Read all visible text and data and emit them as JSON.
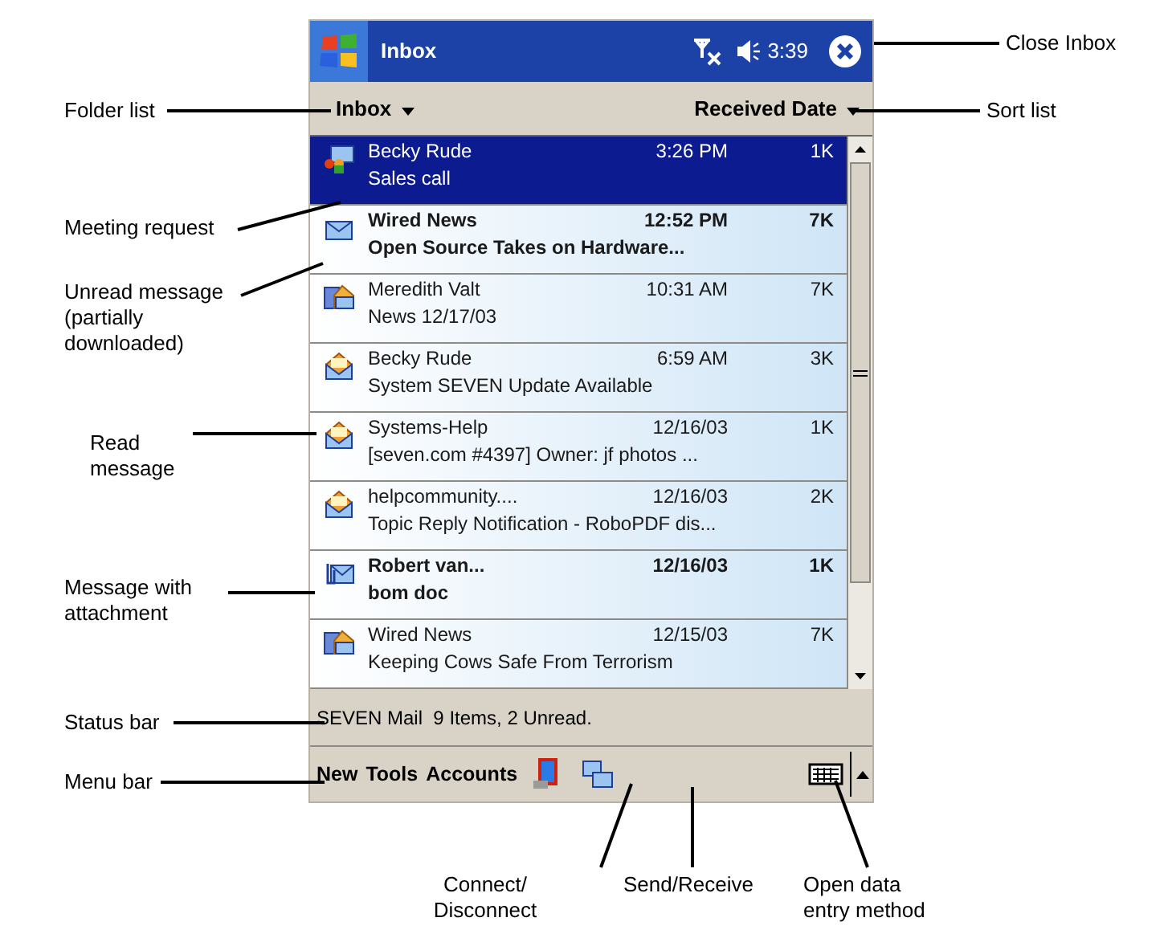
{
  "title_bar": {
    "title": "Inbox",
    "time": "3:39"
  },
  "folder_list": {
    "label": "Inbox"
  },
  "sort_list": {
    "label": "Received Date"
  },
  "messages": [
    {
      "sender": "Becky Rude",
      "time": "3:26 PM",
      "size": "1K",
      "subject": "Sales call",
      "kind": "meeting",
      "unread": false,
      "selected": true
    },
    {
      "sender": "Wired News",
      "time": "12:52 PM",
      "size": "7K",
      "subject": "Open Source Takes on Hardware...",
      "kind": "unread",
      "unread": true,
      "selected": false
    },
    {
      "sender": "Meredith Valt",
      "time": "10:31 AM",
      "size": "7K",
      "subject": "News 12/17/03",
      "kind": "partial",
      "unread": false,
      "selected": false
    },
    {
      "sender": "Becky Rude",
      "time": "6:59 AM",
      "size": "3K",
      "subject": "System SEVEN Update Available",
      "kind": "read",
      "unread": false,
      "selected": false
    },
    {
      "sender": "Systems-Help",
      "time": "12/16/03",
      "size": "1K",
      "subject": "[seven.com #4397] Owner: jf photos ...",
      "kind": "read",
      "unread": false,
      "selected": false
    },
    {
      "sender": "helpcommunity....",
      "time": "12/16/03",
      "size": "2K",
      "subject": "Topic Reply Notification - RoboPDF dis...",
      "kind": "read",
      "unread": false,
      "selected": false
    },
    {
      "sender": "Robert van...",
      "time": "12/16/03",
      "size": "1K",
      "subject": "bom doc",
      "kind": "attachment",
      "unread": true,
      "selected": false
    },
    {
      "sender": "Wired News",
      "time": "12/15/03",
      "size": "7K",
      "subject": "Keeping Cows Safe From Terrorism",
      "kind": "partial",
      "unread": false,
      "selected": false
    }
  ],
  "status_bar": "SEVEN Mail  9 Items, 2 Unread.",
  "menu_bar": [
    "New",
    "Tools",
    "Accounts"
  ],
  "callouts": [
    {
      "text": "Close Inbox"
    },
    {
      "text": "Folder list"
    },
    {
      "text": "Sort list"
    },
    {
      "text": "Meeting request"
    },
    {
      "text": "Unread message (partially downloaded)"
    },
    {
      "text": "Read message"
    },
    {
      "text": "Message with attachment"
    },
    {
      "text": "Status bar"
    },
    {
      "text": "Menu bar"
    },
    {
      "text": "Connect/ Disconnect"
    },
    {
      "text": "Send/Receive"
    },
    {
      "text": "Open data entry method"
    }
  ]
}
